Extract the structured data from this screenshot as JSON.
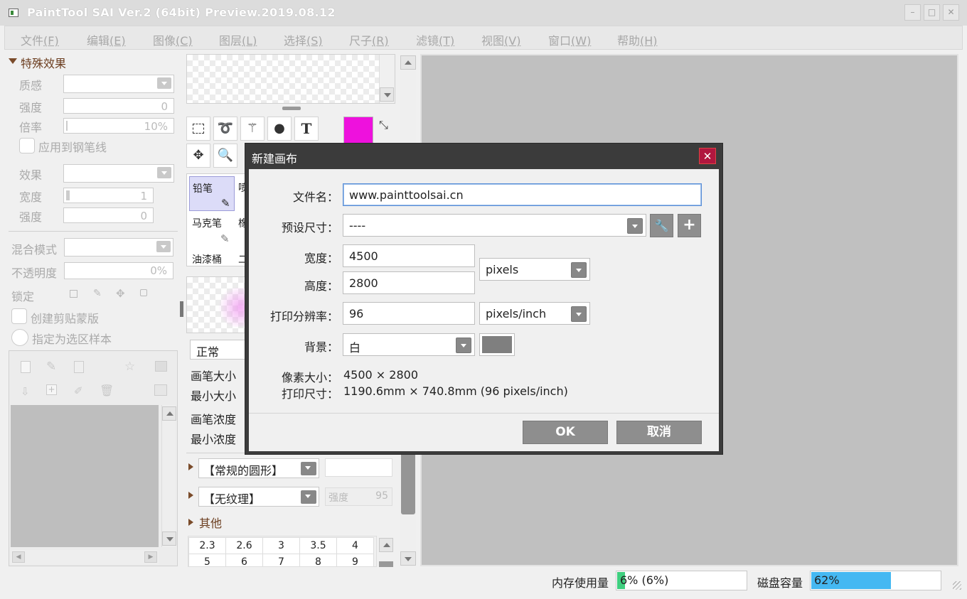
{
  "window": {
    "title": "PaintTool SAI Ver.2 (64bit) Preview.2019.08.12",
    "minimize": "–",
    "maximize": "□",
    "close": "✕"
  },
  "menu": [
    {
      "label": "文件",
      "key": "(F)"
    },
    {
      "label": "编辑",
      "key": "(E)"
    },
    {
      "label": "图像",
      "key": "(C)"
    },
    {
      "label": "图层",
      "key": "(L)"
    },
    {
      "label": "选择",
      "key": "(S)"
    },
    {
      "label": "尺子",
      "key": "(R)"
    },
    {
      "label": "滤镜",
      "key": "(T)"
    },
    {
      "label": "视图",
      "key": "(V)"
    },
    {
      "label": "窗口",
      "key": "(W)"
    },
    {
      "label": "帮助",
      "key": "(H)"
    }
  ],
  "effects": {
    "header": "特殊效果",
    "texture_label": "质感",
    "strength_label": "强度",
    "strength_value": "0",
    "scale_label": "倍率",
    "scale_value": "10%",
    "apply_pen_label": "应用到钢笔线",
    "effect_label": "效果",
    "width_label": "宽度",
    "width_value": "1",
    "strength2_label": "强度",
    "strength2_value": "0"
  },
  "layer_props": {
    "blend_label": "混合模式",
    "opacity_label": "不透明度",
    "opacity_value": "0%",
    "lock_label": "锁定",
    "clip_label": "创建剪贴蒙版",
    "sample_label": "指定为选区样本"
  },
  "tools": {
    "brushes": [
      "铅笔",
      "喷",
      "马克笔",
      "橡",
      "油漆桶",
      "二"
    ],
    "blend_mode": "正常",
    "brush_size": "画笔大小",
    "min_size": "最小大小",
    "brush_density": "画笔浓度",
    "min_density": "最小浓度",
    "shape": "【常规的圆形】",
    "texture": "【无纹理】",
    "texture_strength_label": "强度",
    "texture_strength": "95",
    "other": "其他",
    "sizes": [
      "2.3",
      "2.6",
      "3",
      "3.5",
      "4",
      "5",
      "6",
      "7",
      "8",
      "9"
    ],
    "text_tool": "T",
    "fg_color": "#ee11dd"
  },
  "dialog": {
    "title": "新建画布",
    "close": "✕",
    "filename_label": "文件名：",
    "filename": "www.painttoolsai.cn",
    "preset_label": "预设尺寸：",
    "preset": "----",
    "width_label": "宽度：",
    "width": "4500",
    "height_label": "高度：",
    "height": "2800",
    "unit": "pixels",
    "resolution_label": "打印分辨率：",
    "resolution": "96",
    "res_unit": "pixels/inch",
    "bg_label": "背景：",
    "bg": "白",
    "bg_swatch": "#7f7f7f",
    "pixel_size_label": "像素大小：",
    "pixel_size": "4500 × 2800",
    "print_size_label": "打印尺寸：",
    "print_size": "1190.6mm × 740.8mm (96 pixels/inch)",
    "ok": "OK",
    "cancel": "取消"
  },
  "status": {
    "memory_label": "内存使用量",
    "memory": "6% (6%)",
    "memory_pct": 0.06,
    "memory_color": "#3fcf7f",
    "disk_label": "磁盘容量",
    "disk": "62%",
    "disk_pct": 0.62,
    "disk_color": "#45b8f2"
  }
}
